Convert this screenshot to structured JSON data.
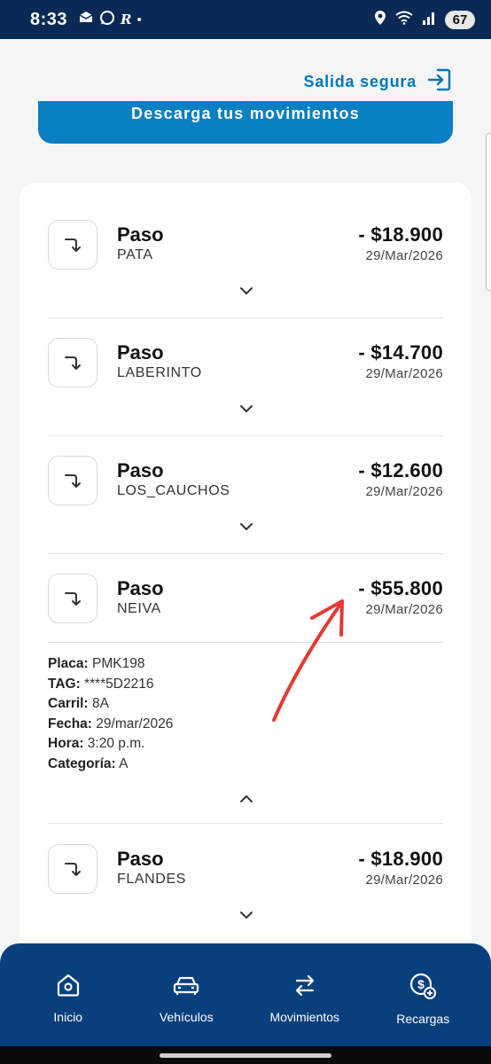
{
  "status_bar": {
    "time": "8:33",
    "battery": "67",
    "icons": [
      "notification-icon",
      "whatsapp-icon",
      "r-app-icon",
      "dot-icon",
      "location-icon",
      "wifi-icon",
      "signal-icon"
    ]
  },
  "header": {
    "logout_label": "Salida segura",
    "download_label": "Descarga tus movimientos"
  },
  "movements": [
    {
      "type": "Paso",
      "place": "PATA",
      "amount": "- $18.900",
      "date": "29/Mar/2026",
      "expanded": false
    },
    {
      "type": "Paso",
      "place": "LABERINTO",
      "amount": "- $14.700",
      "date": "29/Mar/2026",
      "expanded": false
    },
    {
      "type": "Paso",
      "place": "LOS_CAUCHOS",
      "amount": "- $12.600",
      "date": "29/Mar/2026",
      "expanded": false
    },
    {
      "type": "Paso",
      "place": "NEIVA",
      "amount": "- $55.800",
      "date": "29/Mar/2026",
      "expanded": true
    },
    {
      "type": "Paso",
      "place": "FLANDES",
      "amount": "- $18.900",
      "date": "29/Mar/2026",
      "expanded": false
    }
  ],
  "details": {
    "placa_label": "Placa:",
    "placa": "PMK198",
    "tag_label": "TAG:",
    "tag": "****5D2216",
    "carril_label": "Carril:",
    "carril": "8A",
    "fecha_label": "Fecha:",
    "fecha": "29/mar/2026",
    "hora_label": "Hora:",
    "hora": "3:20 p.m.",
    "categoria_label": "Categoría:",
    "categoria": "A"
  },
  "nav": [
    {
      "label": "Inicio",
      "icon": "home-icon"
    },
    {
      "label": "Vehículos",
      "icon": "car-icon"
    },
    {
      "label": "Movimientos",
      "icon": "transfer-arrows-icon"
    },
    {
      "label": "Recargas",
      "icon": "coin-plus-icon"
    }
  ],
  "colors": {
    "status_bar": "#0a2a55",
    "accent": "#0a7fc1",
    "link": "#0077b6",
    "nav_bg": "#0a3f7e",
    "annotation": "#e53935"
  }
}
